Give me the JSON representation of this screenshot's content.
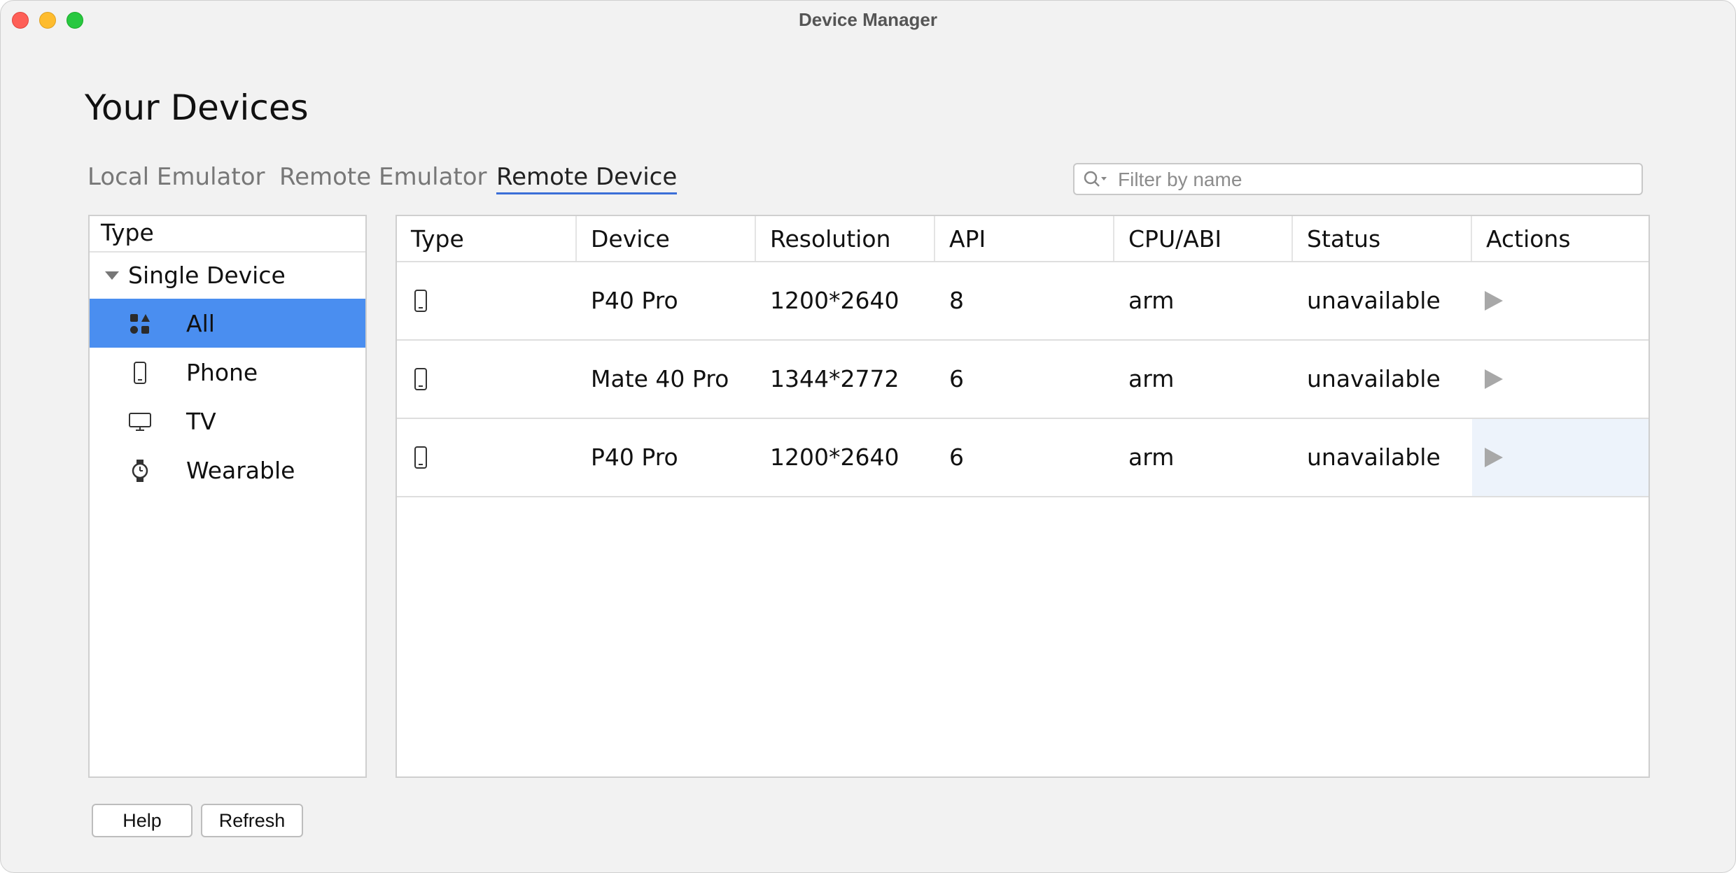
{
  "window": {
    "title": "Device Manager"
  },
  "page": {
    "title": "Your Devices"
  },
  "tabs": [
    {
      "label": "Local Emulator",
      "active": false
    },
    {
      "label": "Remote Emulator",
      "active": false
    },
    {
      "label": "Remote Device",
      "active": true
    }
  ],
  "search": {
    "placeholder": "Filter by name",
    "value": ""
  },
  "type_panel": {
    "header": "Type",
    "group": "Single Device",
    "items": [
      {
        "label": "All",
        "icon": "all-categories-icon",
        "selected": true
      },
      {
        "label": "Phone",
        "icon": "phone-icon",
        "selected": false
      },
      {
        "label": "TV",
        "icon": "tv-icon",
        "selected": false
      },
      {
        "label": "Wearable",
        "icon": "watch-icon",
        "selected": false
      }
    ]
  },
  "table": {
    "columns": [
      "Type",
      "Device",
      "Resolution",
      "API",
      "CPU/ABI",
      "Status",
      "Actions"
    ],
    "rows": [
      {
        "type_icon": "phone-icon",
        "device": "P40 Pro",
        "resolution": "1200*2640",
        "api": "8",
        "cpu": "arm",
        "status": "unavailable",
        "action_icon": "play-icon"
      },
      {
        "type_icon": "phone-icon",
        "device": "Mate 40 Pro",
        "resolution": "1344*2772",
        "api": "6",
        "cpu": "arm",
        "status": "unavailable",
        "action_icon": "play-icon"
      },
      {
        "type_icon": "phone-icon",
        "device": "P40 Pro",
        "resolution": "1200*2640",
        "api": "6",
        "cpu": "arm",
        "status": "unavailable",
        "action_icon": "play-icon"
      }
    ]
  },
  "buttons": {
    "help": "Help",
    "refresh": "Refresh"
  },
  "colors": {
    "selection": "#4a8ef0",
    "active_tab_underline": "#3c6fd8",
    "row_hover": "#edf3fb"
  }
}
